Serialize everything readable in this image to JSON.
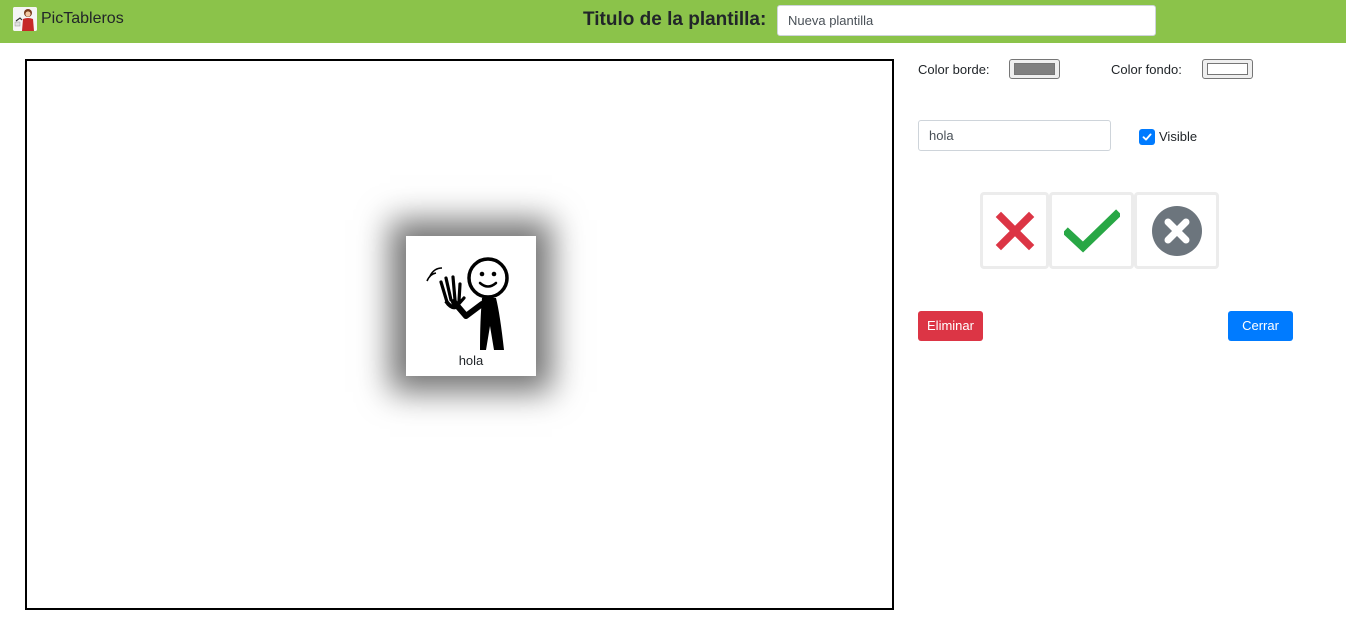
{
  "app": {
    "name": "PicTableros",
    "logo_icon": "pictableros-logo-icon"
  },
  "header": {
    "title_label": "Titulo de la plantilla:",
    "title_value": "Nueva plantilla"
  },
  "canvas": {
    "card": {
      "label": "hola",
      "pictogram": "waving-person-icon"
    }
  },
  "properties": {
    "border_color_label": "Color borde:",
    "border_color": "#808080",
    "background_color_label": "Color fondo:",
    "background_color": "#ffffff",
    "text_value": "hola",
    "visible_label": "Visible",
    "visible_checked": true
  },
  "status_icons": [
    "red-x-icon",
    "green-check-icon",
    "gray-circle-x-icon"
  ],
  "buttons": {
    "delete_label": "Eliminar",
    "close_label": "Cerrar"
  },
  "colors": {
    "topbar": "#8bc34a",
    "danger": "#dc3545",
    "primary": "#007bff",
    "success": "#28a745",
    "secondary": "#6c757d"
  }
}
